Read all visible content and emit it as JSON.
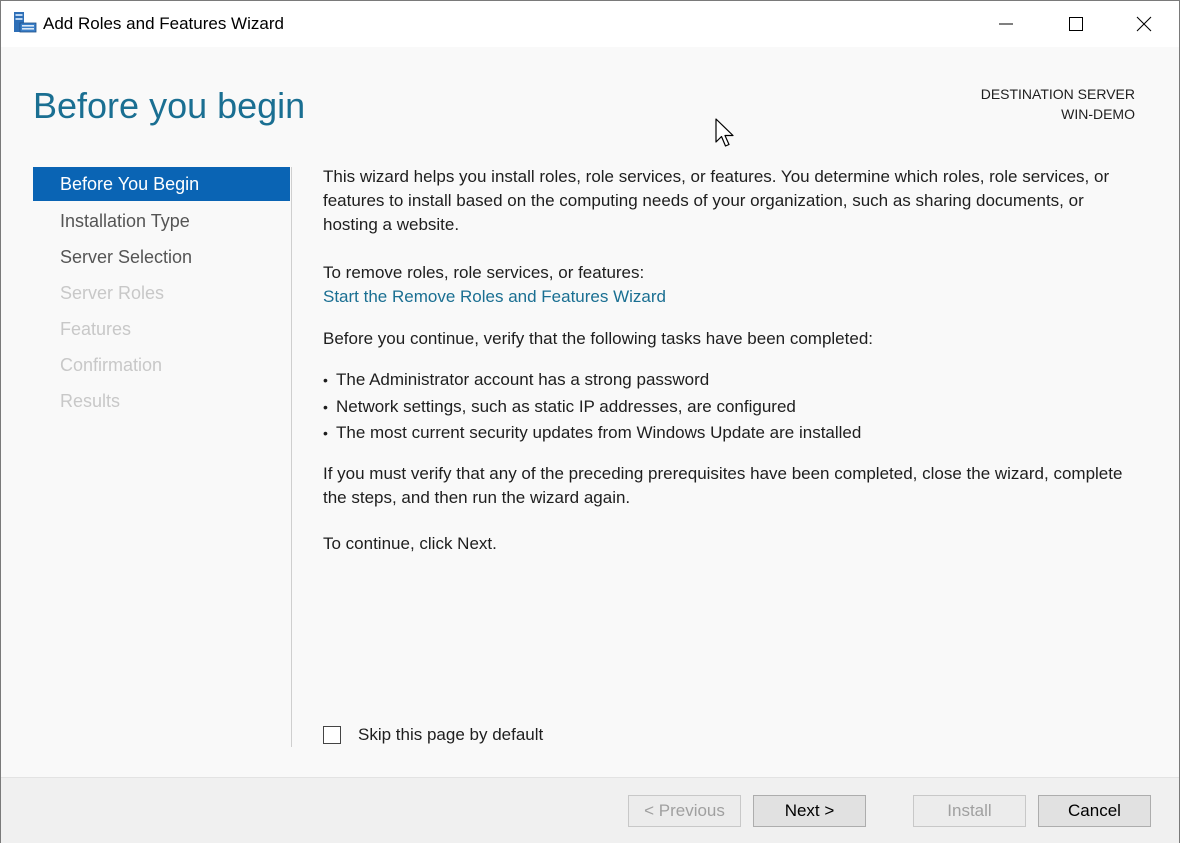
{
  "window": {
    "title": "Add Roles and Features Wizard",
    "icons": [
      "server-manager-app-icon",
      "minimize-icon",
      "maximize-icon",
      "close-icon"
    ]
  },
  "header": {
    "page_title": "Before you begin",
    "destination_label": "DESTINATION SERVER",
    "destination_server": "WIN-DEMO"
  },
  "nav": {
    "items": [
      {
        "label": "Before You Begin",
        "state": "active"
      },
      {
        "label": "Installation Type",
        "state": "enabled"
      },
      {
        "label": "Server Selection",
        "state": "enabled"
      },
      {
        "label": "Server Roles",
        "state": "disabled"
      },
      {
        "label": "Features",
        "state": "disabled"
      },
      {
        "label": "Confirmation",
        "state": "disabled"
      },
      {
        "label": "Results",
        "state": "disabled"
      }
    ]
  },
  "content": {
    "intro": "This wizard helps you install roles, role services, or features. You determine which roles, role services, or features to install based on the computing needs of your organization, such as sharing documents, or hosting a website.",
    "remove_prompt": "To remove roles, role services, or features:",
    "remove_link": "Start the Remove Roles and Features Wizard",
    "verify_prompt": "Before you continue, verify that the following tasks have been completed:",
    "tasks": [
      "The Administrator account has a strong password",
      "Network settings, such as static IP addresses, are configured",
      "The most current security updates from Windows Update are installed"
    ],
    "prereq_note": "If you must verify that any of the preceding prerequisites have been completed, close the wizard, complete the steps, and then run the wizard again.",
    "continue_note": "To continue, click Next."
  },
  "skip_checkbox": {
    "label": "Skip this page by default",
    "checked": false
  },
  "buttons": {
    "previous": "< Previous",
    "next": "Next >",
    "install": "Install",
    "cancel": "Cancel"
  },
  "colors": {
    "accent_heading": "#1a6f92",
    "nav_selected": "#0a64b4",
    "link": "#1a6f92"
  }
}
